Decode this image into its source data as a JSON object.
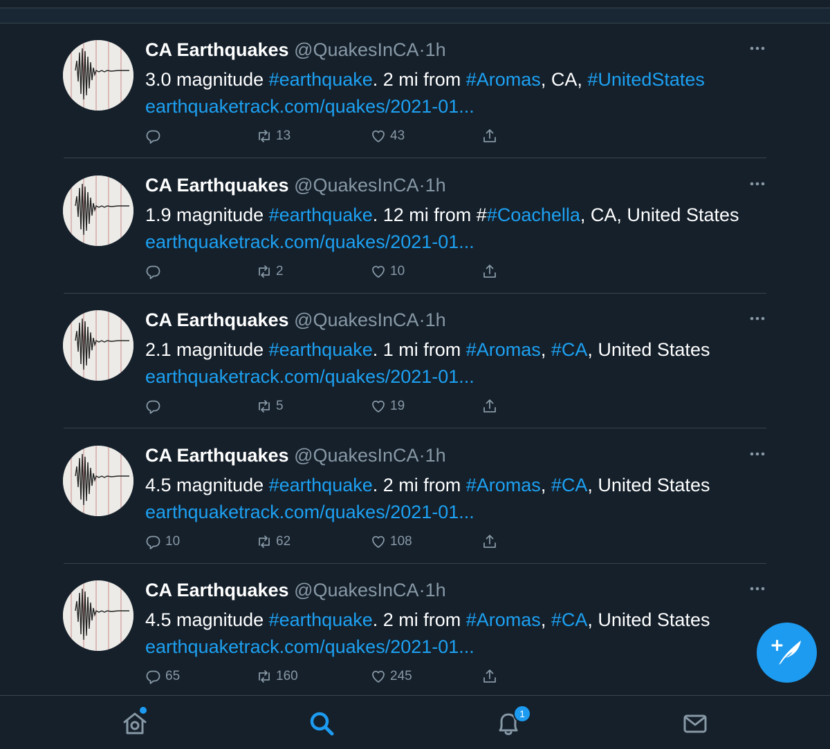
{
  "colors": {
    "background": "#15202b",
    "accent": "#1d9bf0",
    "link": "#1da1f2",
    "muted": "#8899a6",
    "divider": "#38444d"
  },
  "tweets": [
    {
      "name": "CA Earthquakes",
      "handle": "@QuakesInCA",
      "dot": "·",
      "time": "1h",
      "text_parts": [
        {
          "t": "3.0 magnitude ",
          "link": false
        },
        {
          "t": "#earthquake",
          "link": true
        },
        {
          "t": ". 2 mi from ",
          "link": false
        },
        {
          "t": "#Aromas",
          "link": true
        },
        {
          "t": ", CA, ",
          "link": false
        },
        {
          "t": "#UnitedStates",
          "link": true
        }
      ],
      "url": "earthquaketrack.com/quakes/2021-01...",
      "replies": "",
      "retweets": "13",
      "likes": "43"
    },
    {
      "name": "CA Earthquakes",
      "handle": "@QuakesInCA",
      "dot": "·",
      "time": "1h",
      "text_parts": [
        {
          "t": "1.9 magnitude ",
          "link": false
        },
        {
          "t": "#earthquake",
          "link": true
        },
        {
          "t": ". 12 mi from #",
          "link": false
        },
        {
          "t": "#Coachella",
          "link": true
        },
        {
          "t": ", CA, United States",
          "link": false
        }
      ],
      "url": "earthquaketrack.com/quakes/2021-01...",
      "replies": "",
      "retweets": "2",
      "likes": "10"
    },
    {
      "name": "CA Earthquakes",
      "handle": "@QuakesInCA",
      "dot": "·",
      "time": "1h",
      "text_parts": [
        {
          "t": "2.1 magnitude ",
          "link": false
        },
        {
          "t": "#earthquake",
          "link": true
        },
        {
          "t": ". 1 mi from ",
          "link": false
        },
        {
          "t": "#Aromas",
          "link": true
        },
        {
          "t": ", ",
          "link": false
        },
        {
          "t": "#CA",
          "link": true
        },
        {
          "t": ", United States",
          "link": false
        }
      ],
      "url": "earthquaketrack.com/quakes/2021-01...",
      "replies": "",
      "retweets": "5",
      "likes": "19"
    },
    {
      "name": "CA Earthquakes",
      "handle": "@QuakesInCA",
      "dot": "·",
      "time": "1h",
      "text_parts": [
        {
          "t": "4.5 magnitude ",
          "link": false
        },
        {
          "t": "#earthquake",
          "link": true
        },
        {
          "t": ". 2 mi from ",
          "link": false
        },
        {
          "t": "#Aromas",
          "link": true
        },
        {
          "t": ", ",
          "link": false
        },
        {
          "t": "#CA",
          "link": true
        },
        {
          "t": ", United States",
          "link": false
        }
      ],
      "url": "earthquaketrack.com/quakes/2021-01...",
      "replies": "10",
      "retweets": "62",
      "likes": "108"
    },
    {
      "name": "CA Earthquakes",
      "handle": "@QuakesInCA",
      "dot": "·",
      "time": "1h",
      "text_parts": [
        {
          "t": "4.5 magnitude ",
          "link": false
        },
        {
          "t": "#earthquake",
          "link": true
        },
        {
          "t": ". 2 mi from ",
          "link": false
        },
        {
          "t": "#Aromas",
          "link": true
        },
        {
          "t": ", ",
          "link": false
        },
        {
          "t": "#CA",
          "link": true
        },
        {
          "t": ", United States",
          "link": false
        }
      ],
      "url": "earthquaketrack.com/quakes/2021-01...",
      "replies": "65",
      "retweets": "160",
      "likes": "245"
    }
  ],
  "compose_button": {
    "icon": "compose-feather-icon"
  },
  "bottom_nav": {
    "home": {
      "icon": "home-icon",
      "has_dot": true
    },
    "search": {
      "icon": "search-icon",
      "active": true
    },
    "notifications": {
      "icon": "bell-icon",
      "badge": "1"
    },
    "messages": {
      "icon": "mail-icon"
    }
  }
}
